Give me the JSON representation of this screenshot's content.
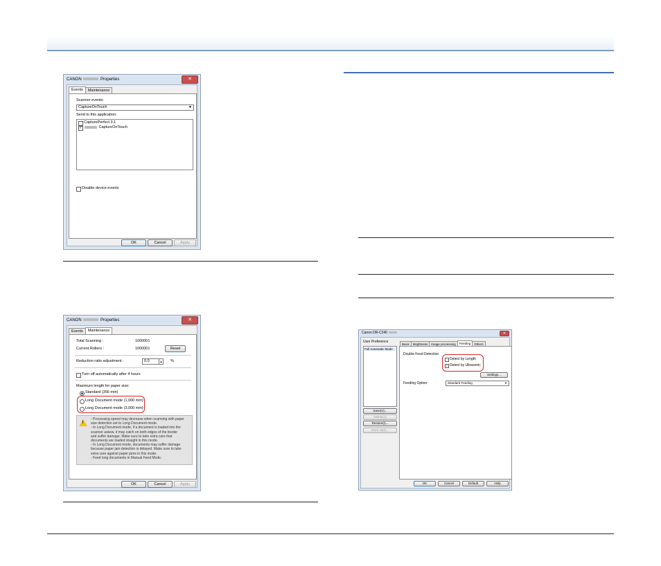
{
  "dialog_events": {
    "title_prefix": "CANON",
    "title_suffix": "Properties",
    "close": "✕",
    "tabs": [
      "Events",
      "Maintenance"
    ],
    "scanner_events_label": "Scanner events:",
    "scanner_events_value": "CaptureOnTouch",
    "send_to_label": "Send to this application:",
    "apps": [
      {
        "label": "CapturePerfect 3.1",
        "checked": false
      },
      {
        "label": "CaptureOnTouch",
        "checked": true
      }
    ],
    "disable_label": "Disable device events",
    "ok": "OK",
    "cancel": "Cancel",
    "apply": "Apply"
  },
  "dialog_maint": {
    "title_prefix": "CANON",
    "title_suffix": "Properties",
    "close": "✕",
    "tabs": [
      "Events",
      "Maintenance"
    ],
    "total_label": "Total Scanning :",
    "total_value": "1000001",
    "rollers_label": "Current Rollers :",
    "rollers_value": "1000001",
    "reset": "Reset",
    "reduction_label": "Reduction ratio adjustment :",
    "reduction_value": "0.0",
    "reduction_unit": "%",
    "turnoff_label": "Turn off automatically after 4 hours",
    "maxlen_label": "Maximum length for paper size:",
    "options": [
      "Standard (356 mm)",
      "Long Document mode (1,000 mm)",
      "Long Document mode (3,000 mm)"
    ],
    "warning_lines": [
      "- Processing speed may decrease when scanning with paper",
      "size detection set to Long Document mode.",
      "- In Long Document mode, if a document is loaded into the",
      "scanner askew, it may catch on both edges of the feeder",
      "and suffer damage. Make sure to take extra care that",
      "documents are loaded straight in this mode.",
      "- In Long Document mode, documents may suffer damage",
      "because paper jam detection is delayed. Make sure to take",
      "extra care against paper jams in this mode.",
      "- Feed long documents in Manual Feed Mode."
    ],
    "ok": "OK",
    "cancel": "Cancel",
    "apply": "Apply"
  },
  "dialog_driver": {
    "title": "Canon DR-C240",
    "close": "✕",
    "user_pref_label": "User Preference",
    "list_item": "Full Automatic Mode",
    "side_buttons": [
      "Save(V)...",
      "Delete(J)",
      "Restore(I)...",
      "Store Up(I)..."
    ],
    "tabs": [
      "Basic",
      "Brightness",
      "Image processing",
      "Feeding",
      "Others"
    ],
    "dfd_label": "Double Feed Detection",
    "detect_length": "Detect by Length",
    "detect_ultra": "Detect by Ultrasonic",
    "settings": "Settings...",
    "feeding_option_label": "Feeding Option:",
    "feeding_option_value": "Standard Feeding",
    "ok": "OK",
    "cancel": "Cancel",
    "default": "Default",
    "help": "Help"
  }
}
